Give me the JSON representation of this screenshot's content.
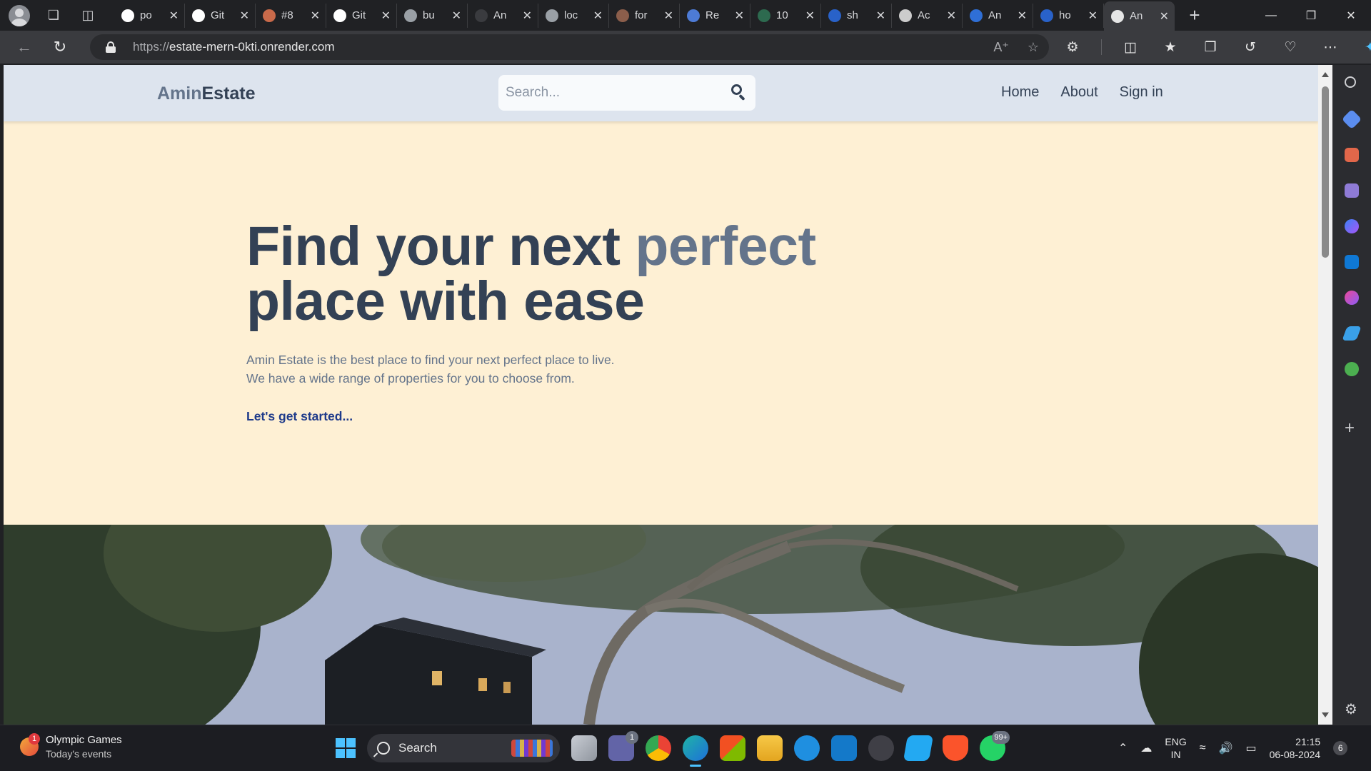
{
  "browser": {
    "tabs": [
      {
        "label": "po",
        "icon": "github-icon",
        "color": "#ffffff"
      },
      {
        "label": "Git",
        "icon": "github-icon",
        "color": "#ffffff"
      },
      {
        "label": "#8",
        "icon": "pe-icon",
        "color": "#c96a4a"
      },
      {
        "label": "Git",
        "icon": "github-icon",
        "color": "#ffffff"
      },
      {
        "label": "bu",
        "icon": "stack-icon",
        "color": "#9aa0a6"
      },
      {
        "label": "An",
        "icon": "ai-icon",
        "color": "#3a3b3f"
      },
      {
        "label": "loc",
        "icon": "dev-icon",
        "color": "#9aa0a6"
      },
      {
        "label": "for",
        "icon": "avatar-icon",
        "color": "#8b5e4b"
      },
      {
        "label": "Re",
        "icon": "doc-icon",
        "color": "#4d7bd6"
      },
      {
        "label": "10",
        "icon": "ghost-icon",
        "color": "#2d6a4f"
      },
      {
        "label": "sh",
        "icon": "search-icon",
        "color": "#2962c9"
      },
      {
        "label": "Ac",
        "icon": "pen-icon",
        "color": "#cccccc"
      },
      {
        "label": "An",
        "icon": "feather-icon",
        "color": "#2f6fd6"
      },
      {
        "label": "ho",
        "icon": "search-icon",
        "color": "#2962c9"
      },
      {
        "label": "An",
        "icon": "page-icon",
        "color": "#e6e6e6",
        "active": true
      }
    ],
    "address": {
      "scheme": "https://",
      "host": "estate-mern-0kti.onrender.com"
    }
  },
  "site": {
    "brand_part1": "Amin",
    "brand_part2": "Estate",
    "search_placeholder": "Search...",
    "nav": {
      "home": "Home",
      "about": "About",
      "signin": "Sign in"
    },
    "hero": {
      "title_part1": "Find your next ",
      "title_accent": "perfect",
      "title_part2": "place with ease",
      "description_line1": "Amin Estate is the best place to find your next perfect place to live.",
      "description_line2": "We have a wide range of properties for you to choose from.",
      "cta": "Let's get started..."
    },
    "colors": {
      "header_bg": "#dde4ee",
      "page_bg": "#fef0d4",
      "slate_dark": "#334155",
      "slate_light": "#64748b",
      "cta": "#1e3a8a"
    }
  },
  "taskbar": {
    "weather_title": "Olympic Games",
    "weather_sub": "Today's events",
    "weather_badge": "1",
    "search_label": "Search",
    "teams_badge": "1",
    "whatsapp_badge": "99+",
    "lang_line1": "ENG",
    "lang_line2": "IN",
    "time": "21:15",
    "date": "06-08-2024",
    "notifications": "6"
  }
}
